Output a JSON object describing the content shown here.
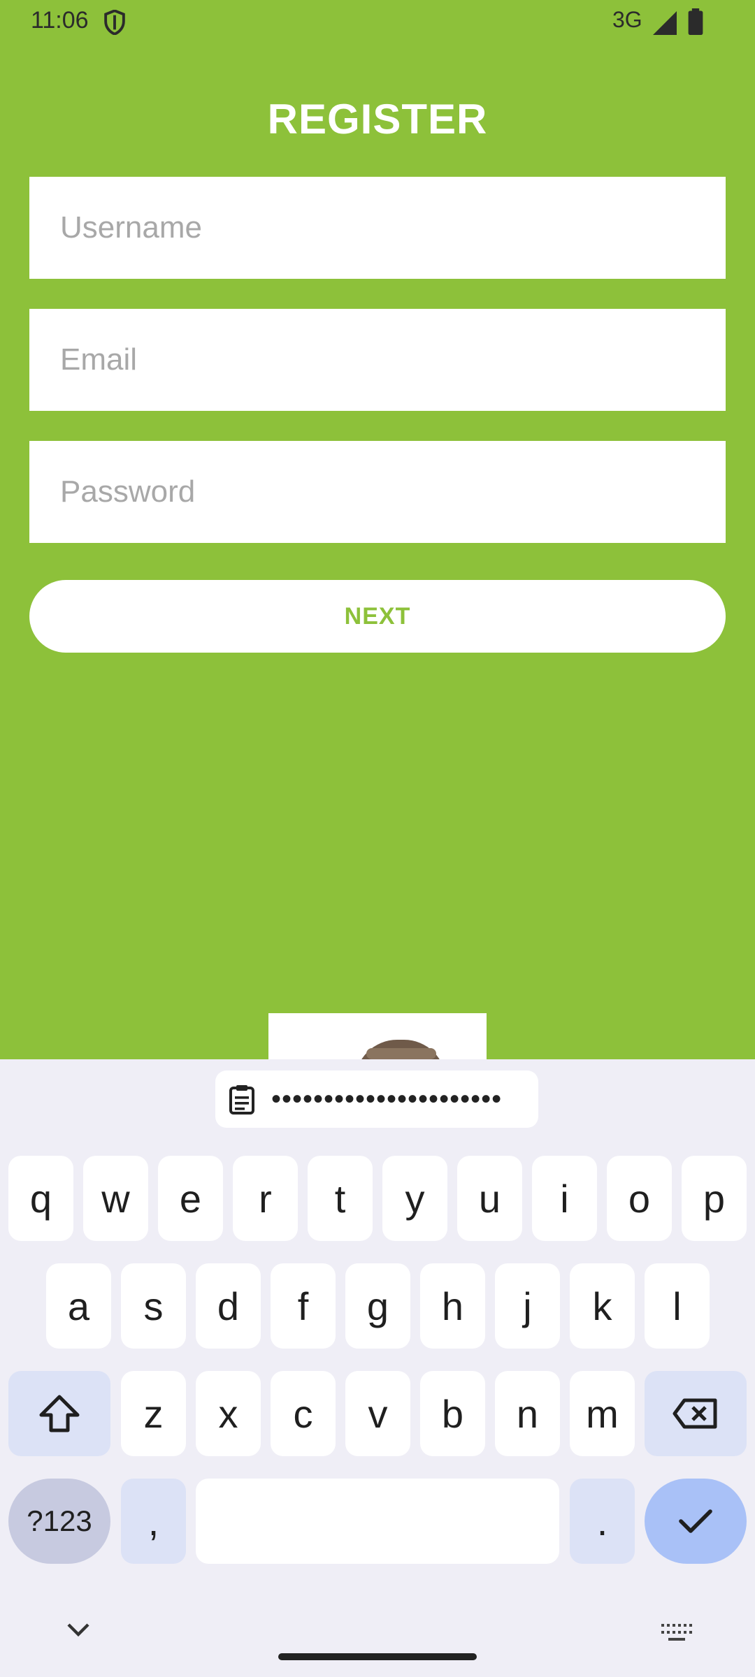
{
  "status_bar": {
    "time": "11:06",
    "network": "3G"
  },
  "app": {
    "title": "REGISTER",
    "fields": {
      "username": {
        "placeholder": "Username",
        "value": ""
      },
      "email": {
        "placeholder": "Email",
        "value": ""
      },
      "password": {
        "placeholder": "Password",
        "value": ""
      }
    },
    "next_label": "NEXT",
    "colors": {
      "background": "#8DC13A",
      "button_text": "#8DC13A"
    }
  },
  "keyboard": {
    "clipboard_suggestion": "••••••••••••••••••••••",
    "row1": [
      "q",
      "w",
      "e",
      "r",
      "t",
      "y",
      "u",
      "i",
      "o",
      "p"
    ],
    "row2": [
      "a",
      "s",
      "d",
      "f",
      "g",
      "h",
      "j",
      "k",
      "l"
    ],
    "row3": [
      "z",
      "x",
      "c",
      "v",
      "b",
      "n",
      "m"
    ],
    "symbols_label": "?123",
    "comma": ",",
    "period": "."
  }
}
